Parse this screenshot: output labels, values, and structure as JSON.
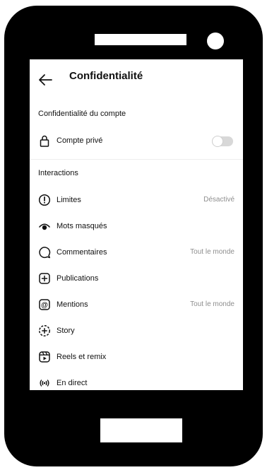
{
  "header": {
    "title": "Confidentialité"
  },
  "account_section": {
    "heading": "Confidentialité du compte",
    "private_account": {
      "label": "Compte privé",
      "enabled": false
    }
  },
  "interactions": {
    "heading": "Interactions",
    "items": [
      {
        "label": "Limites",
        "value": "Désactivé",
        "icon": "exclamation-circle-icon"
      },
      {
        "label": "Mots masqués",
        "value": "",
        "icon": "eye-slash-icon"
      },
      {
        "label": "Commentaires",
        "value": "Tout le monde",
        "icon": "comment-bubble-icon"
      },
      {
        "label": "Publications",
        "value": "",
        "icon": "plus-square-icon"
      },
      {
        "label": "Mentions",
        "value": "Tout le monde",
        "icon": "at-sign-icon"
      },
      {
        "label": "Story",
        "value": "",
        "icon": "story-plus-icon"
      },
      {
        "label": "Reels et remix",
        "value": "",
        "icon": "reels-icon"
      },
      {
        "label": "En direct",
        "value": "",
        "icon": "live-broadcast-icon"
      }
    ]
  }
}
